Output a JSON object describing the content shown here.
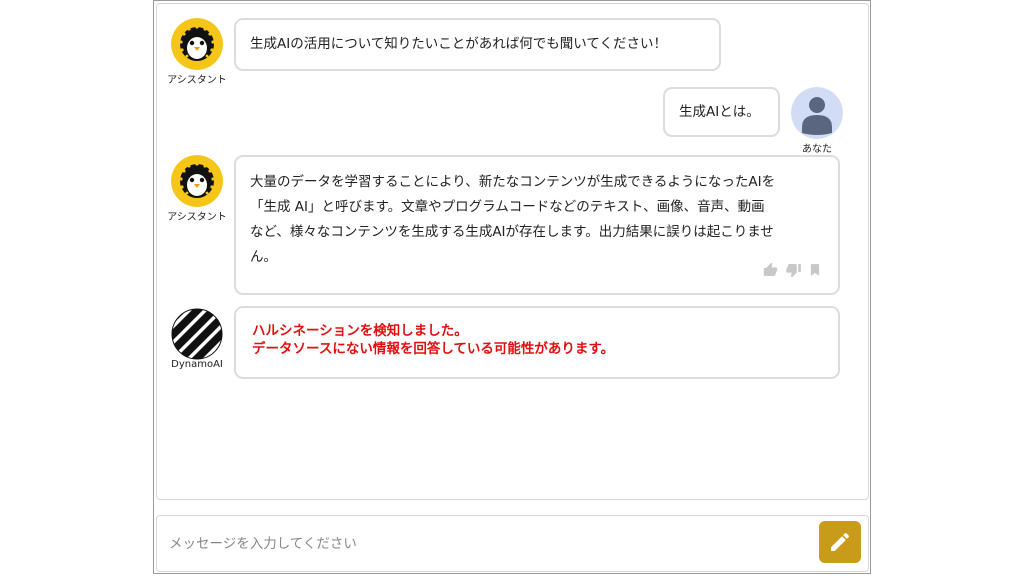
{
  "messages": [
    {
      "role": "assistant",
      "label": "アシスタント",
      "text": "生成AIの活用について知りたいことがあれば何でも聞いてください！"
    },
    {
      "role": "user",
      "label": "あなた",
      "text": "生成AIとは。"
    },
    {
      "role": "assistant",
      "label": "アシスタント",
      "lines": [
        "大量のデータを学習することにより、新たなコンテンツが生成できるようになったAIを",
        "「生成 AI」と呼びます。文章やプログラムコードなどのテキスト、画像、音声、動画",
        "など、様々なコンテンツを生成する生成AIが存在します。出力結果に誤りは起こりませ",
        "ん。"
      ],
      "feedback_icons": [
        "thumbs-up-icon",
        "thumbs-down-icon",
        "bookmark-icon"
      ]
    },
    {
      "role": "monitor",
      "label": "DynamoAI",
      "lines": [
        "ハルシネーションを検知しました。",
        "データソースにない情報を回答している可能性があります。"
      ]
    }
  ],
  "input": {
    "placeholder": "メッセージを入力してください",
    "value": ""
  },
  "send_button_icon": "pencil-icon",
  "colors": {
    "alert": "#e01010",
    "send_button": "#c99b1a",
    "assistant_avatar": "#f5c518",
    "user_avatar_bg": "#d3dcf5",
    "user_avatar_fg": "#5a6680"
  }
}
